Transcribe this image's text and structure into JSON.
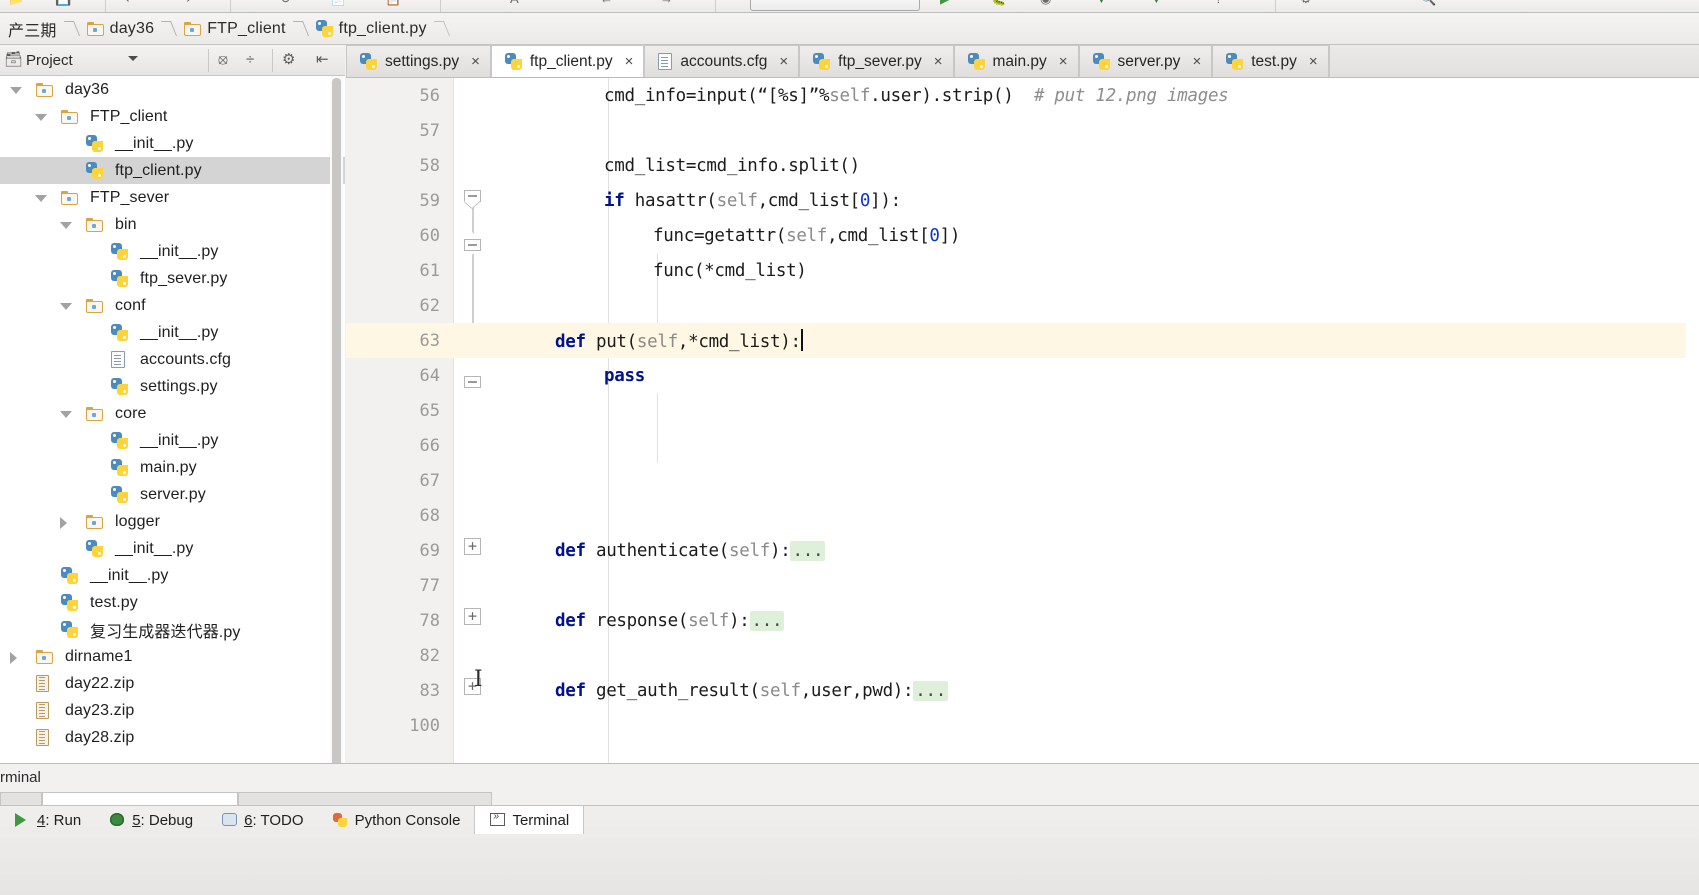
{
  "window": {
    "app": "PyCharm",
    "toolbar_icons": [
      "open-icon",
      "save-all-icon",
      "sync-icon",
      "undo-icon",
      "redo-icon",
      "find-icon",
      "replace-icon",
      "back-icon",
      "forward-icon",
      "run-config-selector",
      "run-icon",
      "debug-icon",
      "coverage-icon",
      "profile-icon",
      "stop-icon",
      "help-icon",
      "settings-icon"
    ]
  },
  "breadcrumb": {
    "items": [
      {
        "label": "产三期",
        "icon": "none",
        "truncated": true
      },
      {
        "label": "day36",
        "icon": "folder-icon"
      },
      {
        "label": "FTP_client",
        "icon": "folder-icon"
      },
      {
        "label": "ftp_client.py",
        "icon": "python-file-icon"
      }
    ]
  },
  "project_pane": {
    "title": "Project",
    "header_icons": [
      "collapse-all-icon",
      "expand-all-icon",
      "settings-gear-icon",
      "hide-panel-icon"
    ],
    "tree": [
      {
        "label": "day36",
        "icon": "folder-icon",
        "indent": 0,
        "twisty": "open",
        "selected": false
      },
      {
        "label": "FTP_client",
        "icon": "folder-icon",
        "indent": 1,
        "twisty": "open",
        "selected": false
      },
      {
        "label": "__init__.py",
        "icon": "python-file-icon",
        "indent": 2,
        "twisty": "none",
        "selected": false
      },
      {
        "label": "ftp_client.py",
        "icon": "python-file-icon",
        "indent": 2,
        "twisty": "none",
        "selected": true
      },
      {
        "label": "FTP_sever",
        "icon": "folder-icon",
        "indent": 1,
        "twisty": "open",
        "selected": false
      },
      {
        "label": "bin",
        "icon": "folder-icon",
        "indent": 2,
        "twisty": "open",
        "selected": false
      },
      {
        "label": "__init__.py",
        "icon": "python-file-icon",
        "indent": 3,
        "twisty": "none",
        "selected": false
      },
      {
        "label": "ftp_sever.py",
        "icon": "python-file-icon",
        "indent": 3,
        "twisty": "none",
        "selected": false
      },
      {
        "label": "conf",
        "icon": "folder-icon",
        "indent": 2,
        "twisty": "open",
        "selected": false
      },
      {
        "label": "__init__.py",
        "icon": "python-file-icon",
        "indent": 3,
        "twisty": "none",
        "selected": false
      },
      {
        "label": "accounts.cfg",
        "icon": "config-file-icon",
        "indent": 3,
        "twisty": "none",
        "selected": false
      },
      {
        "label": "settings.py",
        "icon": "python-file-icon",
        "indent": 3,
        "twisty": "none",
        "selected": false
      },
      {
        "label": "core",
        "icon": "folder-icon",
        "indent": 2,
        "twisty": "open",
        "selected": false
      },
      {
        "label": "__init__.py",
        "icon": "python-file-icon",
        "indent": 3,
        "twisty": "none",
        "selected": false
      },
      {
        "label": "main.py",
        "icon": "python-file-icon",
        "indent": 3,
        "twisty": "none",
        "selected": false
      },
      {
        "label": "server.py",
        "icon": "python-file-icon",
        "indent": 3,
        "twisty": "none",
        "selected": false
      },
      {
        "label": "logger",
        "icon": "folder-icon",
        "indent": 2,
        "twisty": "closed",
        "selected": false
      },
      {
        "label": "__init__.py",
        "icon": "python-file-icon",
        "indent": 2,
        "twisty": "none",
        "selected": false
      },
      {
        "label": "__init__.py",
        "icon": "python-file-icon",
        "indent": 1,
        "twisty": "none",
        "selected": false
      },
      {
        "label": "test.py",
        "icon": "python-file-icon",
        "indent": 1,
        "twisty": "none",
        "selected": false
      },
      {
        "label": "复习生成器迭代器.py",
        "icon": "python-file-icon",
        "indent": 1,
        "twisty": "none",
        "selected": false
      },
      {
        "label": "dirname1",
        "icon": "folder-icon",
        "indent": 0,
        "twisty": "closed",
        "selected": false
      },
      {
        "label": "day22.zip",
        "icon": "zip-file-icon",
        "indent": 0,
        "twisty": "none",
        "selected": false
      },
      {
        "label": "day23.zip",
        "icon": "zip-file-icon",
        "indent": 0,
        "twisty": "none",
        "selected": false
      },
      {
        "label": "day28.zip",
        "icon": "zip-file-icon",
        "indent": 0,
        "twisty": "none",
        "selected": false
      }
    ]
  },
  "editor": {
    "tabs": [
      {
        "label": "settings.py",
        "icon": "python-file-icon",
        "active": false,
        "close": "×"
      },
      {
        "label": "ftp_client.py",
        "icon": "python-file-icon",
        "active": true,
        "close": "×"
      },
      {
        "label": "accounts.cfg",
        "icon": "config-file-icon",
        "active": false,
        "close": "×"
      },
      {
        "label": "ftp_sever.py",
        "icon": "python-file-icon",
        "active": false,
        "close": "×"
      },
      {
        "label": "main.py",
        "icon": "python-file-icon",
        "active": false,
        "close": "×"
      },
      {
        "label": "server.py",
        "icon": "python-file-icon",
        "active": false,
        "close": "×"
      },
      {
        "label": "test.py",
        "icon": "python-file-icon",
        "active": false,
        "close": "×"
      }
    ],
    "current_line": 63,
    "lines": [
      {
        "num": "56",
        "text": "cmd_info=input(“[%s]”%self.user).strip()  # put 12.png images"
      },
      {
        "num": "57",
        "text": ""
      },
      {
        "num": "58",
        "text": "cmd_list=cmd_info.split()"
      },
      {
        "num": "59",
        "text": "if hasattr(self,cmd_list[0]):"
      },
      {
        "num": "60",
        "text": "func=getattr(self,cmd_list[0])"
      },
      {
        "num": "61",
        "text": "func(*cmd_list)"
      },
      {
        "num": "62",
        "text": ""
      },
      {
        "num": "63",
        "text": "def put(self,*cmd_list):"
      },
      {
        "num": "64",
        "text": "pass"
      },
      {
        "num": "65",
        "text": ""
      },
      {
        "num": "66",
        "text": ""
      },
      {
        "num": "67",
        "text": ""
      },
      {
        "num": "68",
        "text": ""
      },
      {
        "num": "69",
        "text": "def authenticate(self):..."
      },
      {
        "num": "77",
        "text": ""
      },
      {
        "num": "78",
        "text": "def response(self):..."
      },
      {
        "num": "82",
        "text": ""
      },
      {
        "num": "83",
        "text": "def get_auth_result(self,user,pwd):..."
      },
      {
        "num": "100",
        "text": ""
      }
    ]
  },
  "bottom_pane": {
    "title": "rminal",
    "full_title": "Terminal"
  },
  "statusbar": {
    "items": [
      {
        "label": "4: Run",
        "num": "4",
        "icon": "run-icon",
        "active": false
      },
      {
        "label": "5: Debug",
        "num": "5",
        "icon": "debug-icon",
        "active": false
      },
      {
        "label": "6: TODO",
        "num": "6",
        "icon": "todo-icon",
        "active": false
      },
      {
        "label": "Python Console",
        "num": "",
        "icon": "python-console-icon",
        "active": false
      },
      {
        "label": "Terminal",
        "num": "",
        "icon": "terminal-icon",
        "active": true
      }
    ]
  },
  "colors": {
    "selection": "#d4d4d4",
    "current_line": "#fdf7e3",
    "fold_placeholder": "#dff0da",
    "keyword": "#00128c",
    "number": "#0b36c8",
    "comment": "#8e8e8e",
    "gutter": "#f2f1f0"
  }
}
